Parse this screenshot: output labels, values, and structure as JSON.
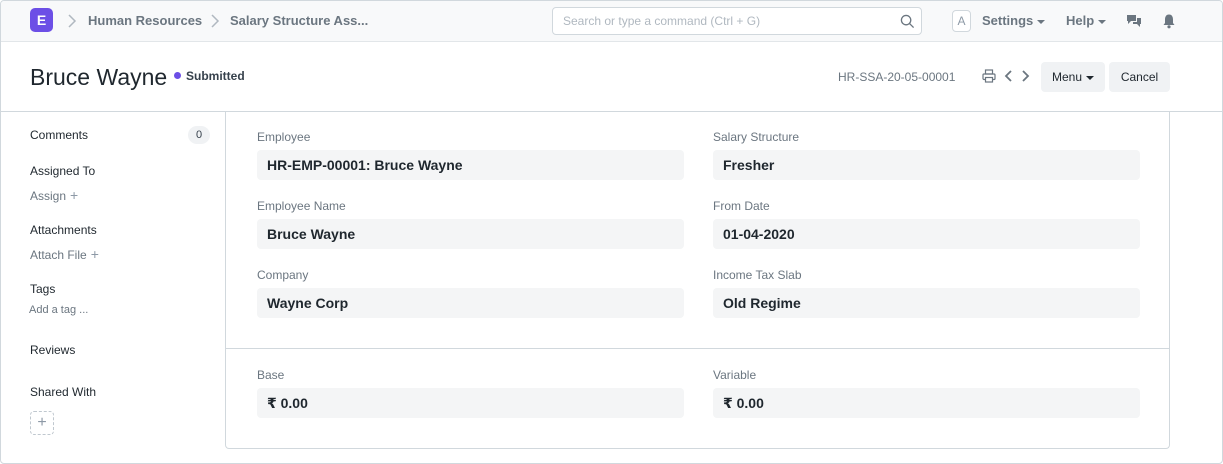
{
  "navbar": {
    "logo_letter": "E",
    "breadcrumbs": [
      "Human Resources",
      "Salary Structure Ass..."
    ],
    "search_placeholder": "Search or type a command (Ctrl + G)",
    "avatar_letter": "A",
    "settings_label": "Settings",
    "help_label": "Help"
  },
  "header": {
    "title": "Bruce Wayne",
    "status": "Submitted",
    "doc_name": "HR-SSA-20-05-00001",
    "menu_label": "Menu",
    "cancel_label": "Cancel"
  },
  "sidebar": {
    "comments_label": "Comments",
    "comments_count": "0",
    "assigned_to_label": "Assigned To",
    "assign_link": "Assign",
    "attachments_label": "Attachments",
    "attach_link": "Attach File",
    "tags_label": "Tags",
    "add_tag_link": "Add a tag ...",
    "reviews_label": "Reviews",
    "shared_with_label": "Shared With"
  },
  "form": {
    "employee": {
      "label": "Employee",
      "value": "HR-EMP-00001: Bruce Wayne"
    },
    "salary_structure": {
      "label": "Salary Structure",
      "value": "Fresher"
    },
    "employee_name": {
      "label": "Employee Name",
      "value": "Bruce Wayne"
    },
    "from_date": {
      "label": "From Date",
      "value": "01-04-2020"
    },
    "company": {
      "label": "Company",
      "value": "Wayne Corp"
    },
    "income_tax_slab": {
      "label": "Income Tax Slab",
      "value": "Old Regime"
    },
    "base": {
      "label": "Base",
      "value": "₹ 0.00"
    },
    "variable": {
      "label": "Variable",
      "value": "₹ 0.00"
    }
  },
  "colors": {
    "brand": "#6c4fe6",
    "status_dot": "#6c4fe6"
  }
}
